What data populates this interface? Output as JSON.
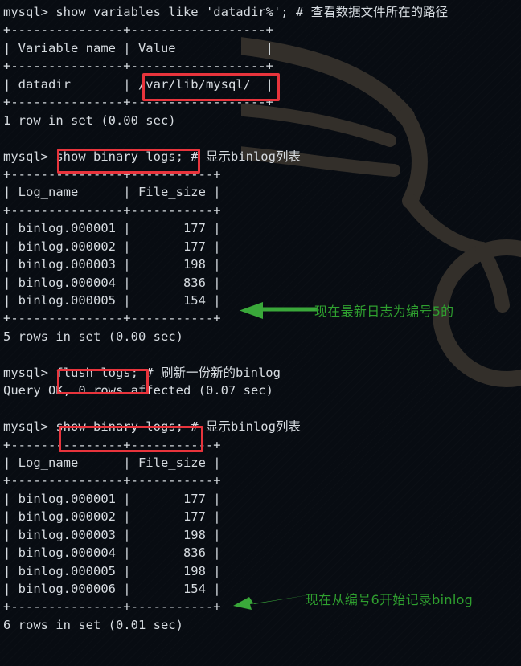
{
  "terminal": {
    "prompt": "mysql>",
    "colors": {
      "background": "#080c12",
      "foreground": "#d6dbe0",
      "highlight_box": "#e8343c",
      "annotation_green": "#2fa02f"
    },
    "lines": [
      "mysql> show variables like 'datadir%'; # 查看数据文件所在的路径",
      "+---------------+------------------+",
      "| Variable_name | Value            |",
      "+---------------+------------------+",
      "| datadir       | /var/lib/mysql/  |",
      "+---------------+------------------+",
      "1 row in set (0.00 sec)",
      "",
      "mysql> show binary logs; # 显示binlog列表",
      "+---------------+-----------+",
      "| Log_name      | File_size |",
      "+---------------+-----------+",
      "| binlog.000001 |       177 |",
      "| binlog.000002 |       177 |",
      "| binlog.000003 |       198 |",
      "| binlog.000004 |       836 |",
      "| binlog.000005 |       154 |",
      "+---------------+-----------+",
      "5 rows in set (0.00 sec)",
      "",
      "mysql> flush logs; # 刷新一份新的binlog",
      "Query OK, 0 rows affected (0.07 sec)",
      "",
      "mysql> show binary logs; # 显示binlog列表",
      "+---------------+-----------+",
      "| Log_name      | File_size |",
      "+---------------+-----------+",
      "| binlog.000001 |       177 |",
      "| binlog.000002 |       177 |",
      "| binlog.000003 |       198 |",
      "| binlog.000004 |       836 |",
      "| binlog.000005 |       198 |",
      "| binlog.000006 |       154 |",
      "+---------------+-----------+",
      "6 rows in set (0.01 sec)"
    ]
  },
  "commands": [
    {
      "id": "show-variables-datadir",
      "sql": "show variables like 'datadir%';",
      "comment": "# 查看数据文件所在的路径",
      "result_footer": "1 row in set (0.00 sec)"
    },
    {
      "id": "show-binary-logs-first",
      "sql": "show binary logs;",
      "comment": "# 显示binlog列表",
      "result_footer": "5 rows in set (0.00 sec)"
    },
    {
      "id": "flush-logs",
      "sql": "flush logs;",
      "comment": "# 刷新一份新的binlog",
      "result_footer": "Query OK, 0 rows affected (0.07 sec)"
    },
    {
      "id": "show-binary-logs-second",
      "sql": "show binary logs;",
      "comment": "# 显示binlog列表",
      "result_footer": "6 rows in set (0.01 sec)"
    }
  ],
  "tables": {
    "variables": {
      "headers": [
        "Variable_name",
        "Value"
      ],
      "rows": [
        [
          "datadir",
          "/var/lib/mysql/"
        ]
      ]
    },
    "binary_logs_first": {
      "headers": [
        "Log_name",
        "File_size"
      ],
      "rows": [
        [
          "binlog.000001",
          "177"
        ],
        [
          "binlog.000002",
          "177"
        ],
        [
          "binlog.000003",
          "198"
        ],
        [
          "binlog.000004",
          "836"
        ],
        [
          "binlog.000005",
          "154"
        ]
      ]
    },
    "binary_logs_second": {
      "headers": [
        "Log_name",
        "File_size"
      ],
      "rows": [
        [
          "binlog.000001",
          "177"
        ],
        [
          "binlog.000002",
          "177"
        ],
        [
          "binlog.000003",
          "198"
        ],
        [
          "binlog.000004",
          "836"
        ],
        [
          "binlog.000005",
          "198"
        ],
        [
          "binlog.000006",
          "154"
        ]
      ]
    }
  },
  "highlights": [
    {
      "id": "datadir-value-highlight",
      "target": "/var/lib/mysql/"
    },
    {
      "id": "show-binary-logs-highlight-1",
      "target": "show binary logs;"
    },
    {
      "id": "flush-logs-highlight",
      "target": "flush logs;"
    },
    {
      "id": "show-binary-logs-highlight-2",
      "target": "show binary logs;"
    }
  ],
  "annotations": [
    {
      "id": "latest-log-note",
      "text": "现在最新日志为编号5的",
      "arrow": "left-arrow-icon"
    },
    {
      "id": "new-binlog-note",
      "text": "现在从编号6开始记录binlog",
      "arrow": "left-arrow-icon"
    }
  ]
}
